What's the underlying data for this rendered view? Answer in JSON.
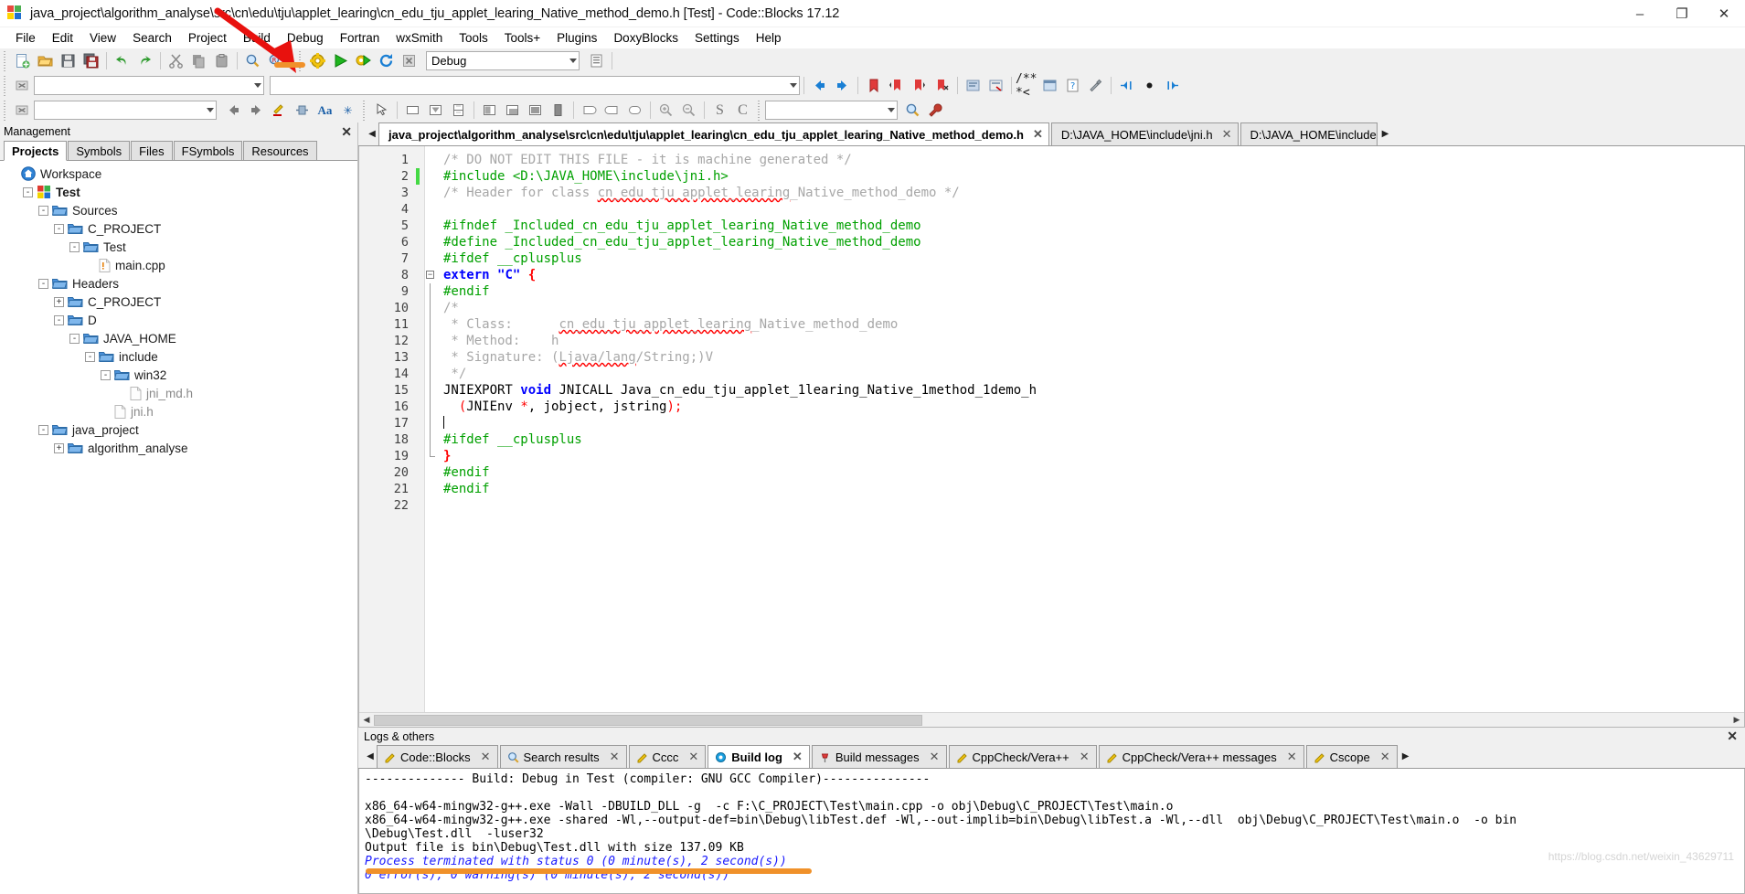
{
  "window": {
    "title": "java_project\\algorithm_analyse\\src\\cn\\edu\\tju\\applet_learing\\cn_edu_tju_applet_learing_Native_method_demo.h [Test] - Code::Blocks 17.12",
    "app_icon": "codeblocks-logo-icon",
    "minimize": "–",
    "maximize": "❐",
    "close": "✕"
  },
  "menu": {
    "items": [
      {
        "label": "File"
      },
      {
        "label": "Edit"
      },
      {
        "label": "View"
      },
      {
        "label": "Search"
      },
      {
        "label": "Project"
      },
      {
        "label": "Build"
      },
      {
        "label": "Debug"
      },
      {
        "label": "Fortran"
      },
      {
        "label": "wxSmith"
      },
      {
        "label": "Tools"
      },
      {
        "label": "Tools+"
      },
      {
        "label": "Plugins"
      },
      {
        "label": "DoxyBlocks"
      },
      {
        "label": "Settings"
      },
      {
        "label": "Help"
      }
    ]
  },
  "toolbar": {
    "row1": {
      "file_buttons": [
        "new-file-icon",
        "open-file-icon",
        "save-icon",
        "save-all-icon"
      ],
      "undo_buttons": [
        "undo-icon",
        "redo-icon"
      ],
      "clipboard_buttons": [
        "cut-icon",
        "copy-icon",
        "paste-icon"
      ],
      "find_buttons": [
        "find-icon",
        "replace-icon"
      ],
      "build_buttons": [
        "build-icon",
        "run-icon",
        "build-and-run-icon",
        "rebuild-icon",
        "abort-icon"
      ],
      "target_combo": {
        "value": "Debug",
        "placeholder": ""
      },
      "debug_buttons": [
        "debug-continue-icon",
        "debug-run-to-cursor-icon",
        "debug-next-line-icon",
        "debug-step-into-icon",
        "debug-step-out-icon",
        "debug-next-instruction-icon",
        "debug-step-instruction-icon",
        "debug-break-icon",
        "debug-stop-icon",
        "debugging-windows-icon",
        "various-info-icon"
      ]
    },
    "row2": {
      "symbol_combo": {
        "value": "",
        "placeholder": ""
      },
      "function_combo": {
        "value": "",
        "placeholder": ""
      },
      "nav_buttons": [
        "back-icon",
        "forward-icon",
        "bookmark-toggle-icon",
        "bookmark-prev-icon",
        "bookmark-next-icon",
        "bookmark-clear-icon",
        "comment-icon",
        "uncomment-icon",
        "doxyblocks-icon",
        "doxywizard-icon",
        "extract-docs-icon",
        "doxy-settings-icon",
        "goto-start-icon",
        "goto-mid-icon",
        "goto-end-icon"
      ]
    },
    "row3": {
      "close_button": "clear-icon",
      "search_combo": {
        "value": "",
        "placeholder": ""
      },
      "arrow_buttons": [
        "prev-icon",
        "next-icon"
      ],
      "edit_buttons": [
        "highlight-icon",
        "align-icon",
        "font-icon",
        "more-icon"
      ],
      "select_buttons": [
        "pointer-icon"
      ],
      "shape_buttons": [
        "rect-icon",
        "shape-down-icon",
        "shape-split-icon"
      ],
      "align_buttons": [
        "align-top-icon",
        "align-bottom-icon",
        "align-center-icon",
        "fill-icon"
      ],
      "round_buttons": [
        "round-left-icon",
        "round-right-icon",
        "round-all-icon"
      ],
      "zoom_buttons": [
        "zoom-in-icon",
        "zoom-out-icon"
      ],
      "scope_buttons": [
        "s-icon",
        "c-icon"
      ],
      "scope_combo": {
        "value": "",
        "placeholder": ""
      },
      "trailing_buttons": [
        "search-settings-icon",
        "wrench-icon"
      ]
    }
  },
  "management": {
    "title": "Management",
    "close_icon": "✕",
    "tabs": [
      {
        "label": "Projects",
        "active": true
      },
      {
        "label": "Symbols",
        "active": false
      },
      {
        "label": "Files",
        "active": false
      },
      {
        "label": "FSymbols",
        "active": false
      },
      {
        "label": "Resources",
        "active": false
      }
    ],
    "tree": [
      {
        "label": "Workspace",
        "indent": 0,
        "icon": "workspace-icon",
        "expander": "",
        "bold": false,
        "grey": false
      },
      {
        "label": "Test",
        "indent": 1,
        "icon": "project-icon",
        "expander": "-",
        "bold": true,
        "grey": false
      },
      {
        "label": "Sources",
        "indent": 2,
        "icon": "folder-icon",
        "expander": "-",
        "bold": false,
        "grey": false
      },
      {
        "label": "C_PROJECT",
        "indent": 3,
        "icon": "folder-icon",
        "expander": "-",
        "bold": false,
        "grey": false
      },
      {
        "label": "Test",
        "indent": 4,
        "icon": "folder-icon",
        "expander": "-",
        "bold": false,
        "grey": false
      },
      {
        "label": "main.cpp",
        "indent": 5,
        "icon": "source-file-icon",
        "expander": "",
        "bold": false,
        "grey": false
      },
      {
        "label": "Headers",
        "indent": 2,
        "icon": "folder-icon",
        "expander": "-",
        "bold": false,
        "grey": false
      },
      {
        "label": "C_PROJECT",
        "indent": 3,
        "icon": "folder-icon",
        "expander": "+",
        "bold": false,
        "grey": false
      },
      {
        "label": "D",
        "indent": 3,
        "icon": "folder-icon",
        "expander": "-",
        "bold": false,
        "grey": false
      },
      {
        "label": "JAVA_HOME",
        "indent": 4,
        "icon": "folder-icon",
        "expander": "-",
        "bold": false,
        "grey": false
      },
      {
        "label": "include",
        "indent": 5,
        "icon": "folder-icon",
        "expander": "-",
        "bold": false,
        "grey": false
      },
      {
        "label": "win32",
        "indent": 6,
        "icon": "folder-icon",
        "expander": "-",
        "bold": false,
        "grey": false
      },
      {
        "label": "jni_md.h",
        "indent": 7,
        "icon": "header-file-icon",
        "expander": "",
        "bold": false,
        "grey": true
      },
      {
        "label": "jni.h",
        "indent": 6,
        "icon": "header-file-icon",
        "expander": "",
        "bold": false,
        "grey": true
      },
      {
        "label": "java_project",
        "indent": 2,
        "icon": "folder-icon",
        "expander": "-",
        "bold": false,
        "grey": false
      },
      {
        "label": "algorithm_analyse",
        "indent": 3,
        "icon": "folder-icon",
        "expander": "+",
        "bold": false,
        "grey": false
      }
    ]
  },
  "editor": {
    "tabs": [
      {
        "label": "java_project\\algorithm_analyse\\src\\cn\\edu\\tju\\applet_learing\\cn_edu_tju_applet_learing_Native_method_demo.h",
        "active": true,
        "close": "✕"
      },
      {
        "label": "D:\\JAVA_HOME\\include\\jni.h",
        "active": false,
        "close": "✕"
      },
      {
        "label": "D:\\JAVA_HOME\\include",
        "active": false,
        "close": "✕"
      }
    ],
    "scroll_left_arrow": "◀",
    "scroll_right_arrow": "▶",
    "line_numbers": [
      "1",
      "2",
      "3",
      "4",
      "5",
      "6",
      "7",
      "8",
      "9",
      "10",
      "11",
      "12",
      "13",
      "14",
      "15",
      "16",
      "17",
      "18",
      "19",
      "20",
      "21",
      "22"
    ],
    "code_lines": [
      {
        "n": 1,
        "segments": [
          {
            "t": "/* DO NOT EDIT THIS FILE - it is machine generated */",
            "c": "comment"
          }
        ]
      },
      {
        "n": 2,
        "modified": true,
        "segments": [
          {
            "t": "#include <D:\\JAVA_HOME\\include\\jni.h>",
            "c": "pre"
          }
        ]
      },
      {
        "n": 3,
        "segments": [
          {
            "t": "/* Header for class ",
            "c": "comment"
          },
          {
            "t": "cn_edu_tju_applet_learing",
            "c": "comment-sq"
          },
          {
            "t": "_Native_method_demo */",
            "c": "comment"
          }
        ]
      },
      {
        "n": 4,
        "segments": []
      },
      {
        "n": 5,
        "segments": [
          {
            "t": "#ifndef _Included_cn_edu_tju_applet_learing_Native_method_demo",
            "c": "pre"
          }
        ]
      },
      {
        "n": 6,
        "segments": [
          {
            "t": "#define _Included_cn_edu_tju_applet_learing_Native_method_demo",
            "c": "pre"
          }
        ]
      },
      {
        "n": 7,
        "segments": [
          {
            "t": "#ifdef __cplusplus",
            "c": "pre"
          }
        ]
      },
      {
        "n": 8,
        "fold": "open",
        "segments": [
          {
            "t": "extern ",
            "c": "kw"
          },
          {
            "t": "\"C\"",
            "c": "str"
          },
          {
            "t": " {",
            "c": "brace"
          }
        ]
      },
      {
        "n": 9,
        "segments": [
          {
            "t": "#endif",
            "c": "pre"
          }
        ]
      },
      {
        "n": 10,
        "segments": [
          {
            "t": "/*",
            "c": "comment"
          }
        ]
      },
      {
        "n": 11,
        "segments": [
          {
            "t": " * Class:      ",
            "c": "comment"
          },
          {
            "t": "cn_edu_tju_applet_learing",
            "c": "comment-sq"
          },
          {
            "t": "_Native_method_demo",
            "c": "comment"
          }
        ]
      },
      {
        "n": 12,
        "segments": [
          {
            "t": " * Method:    h",
            "c": "comment"
          }
        ]
      },
      {
        "n": 13,
        "segments": [
          {
            "t": " * Signature: (",
            "c": "comment"
          },
          {
            "t": "Ljava/lang",
            "c": "comment-sq"
          },
          {
            "t": "/String;)V",
            "c": "comment"
          }
        ]
      },
      {
        "n": 14,
        "segments": [
          {
            "t": " */",
            "c": "comment"
          }
        ]
      },
      {
        "n": 15,
        "segments": [
          {
            "t": "JNIEXPORT ",
            "c": "plain"
          },
          {
            "t": "void",
            "c": "kw"
          },
          {
            "t": " JNICALL Java_cn_edu_tju_applet_1learing_Native_1method_1demo_h",
            "c": "plain"
          }
        ]
      },
      {
        "n": 16,
        "segments": [
          {
            "t": "  (",
            "c": "punct"
          },
          {
            "t": "JNIEnv ",
            "c": "plain"
          },
          {
            "t": "*",
            "c": "punct"
          },
          {
            "t": ", jobject, jstring",
            "c": "plain"
          },
          {
            "t": ");",
            "c": "punct"
          }
        ]
      },
      {
        "n": 17,
        "caret": true,
        "segments": []
      },
      {
        "n": 18,
        "segments": [
          {
            "t": "#ifdef __cplusplus",
            "c": "pre"
          }
        ]
      },
      {
        "n": 19,
        "fold": "end",
        "segments": [
          {
            "t": "}",
            "c": "brace"
          }
        ]
      },
      {
        "n": 20,
        "segments": [
          {
            "t": "#endif",
            "c": "pre"
          }
        ]
      },
      {
        "n": 21,
        "segments": [
          {
            "t": "#endif",
            "c": "pre"
          }
        ]
      },
      {
        "n": 22,
        "segments": []
      }
    ]
  },
  "logs": {
    "title": "Logs & others",
    "close_icon": "✕",
    "scroll_left_arrow": "◀",
    "scroll_right_arrow": "▶",
    "tabs": [
      {
        "label": "Code::Blocks",
        "icon": "pencil-icon",
        "active": false,
        "close": "✕"
      },
      {
        "label": "Search results",
        "icon": "magnifier-icon",
        "active": false,
        "close": "✕"
      },
      {
        "label": "Cccc",
        "icon": "pencil-icon",
        "active": false,
        "close": "✕"
      },
      {
        "label": "Build log",
        "icon": "gear-blue-icon",
        "active": true,
        "close": "✕"
      },
      {
        "label": "Build messages",
        "icon": "pin-icon",
        "active": false,
        "close": "✕"
      },
      {
        "label": "CppCheck/Vera++",
        "icon": "pencil-icon",
        "active": false,
        "close": "✕"
      },
      {
        "label": "CppCheck/Vera++ messages",
        "icon": "pencil-icon",
        "active": false,
        "close": "✕"
      },
      {
        "label": "Cscope",
        "icon": "pencil-icon",
        "active": false,
        "close": "✕"
      }
    ],
    "build_log": [
      {
        "text": "-------------- Build: Debug in Test (compiler: GNU GCC Compiler)---------------",
        "style": "normal"
      },
      {
        "text": "",
        "style": "normal"
      },
      {
        "text": "x86_64-w64-mingw32-g++.exe -Wall -DBUILD_DLL -g  -c F:\\C_PROJECT\\Test\\main.cpp -o obj\\Debug\\C_PROJECT\\Test\\main.o",
        "style": "normal"
      },
      {
        "text": "x86_64-w64-mingw32-g++.exe -shared -Wl,--output-def=bin\\Debug\\libTest.def -Wl,--out-implib=bin\\Debug\\libTest.a -Wl,--dll  obj\\Debug\\C_PROJECT\\Test\\main.o  -o bin",
        "style": "normal"
      },
      {
        "text": "\\Debug\\Test.dll  -luser32",
        "style": "normal"
      },
      {
        "text": "Output file is bin\\Debug\\Test.dll with size 137.09 KB",
        "style": "normal"
      },
      {
        "text": "Process terminated with status 0 (0 minute(s), 2 second(s))",
        "style": "italic-blue"
      },
      {
        "text": "0 error(s), 0 warning(s) (0 minute(s), 2 second(s))",
        "style": "italic-blue"
      }
    ],
    "watermark": "https://blog.csdn.net/weixin_43629711"
  },
  "colors": {
    "accent_blue": "#1f6fd0",
    "annotation_red": "#e8110e",
    "annotation_orange": "#f0912a",
    "preprocessor_green": "#00a000",
    "comment_grey": "#a7a7a7",
    "keyword_blue": "#0000ff",
    "log_blue": "#1a1aff"
  }
}
